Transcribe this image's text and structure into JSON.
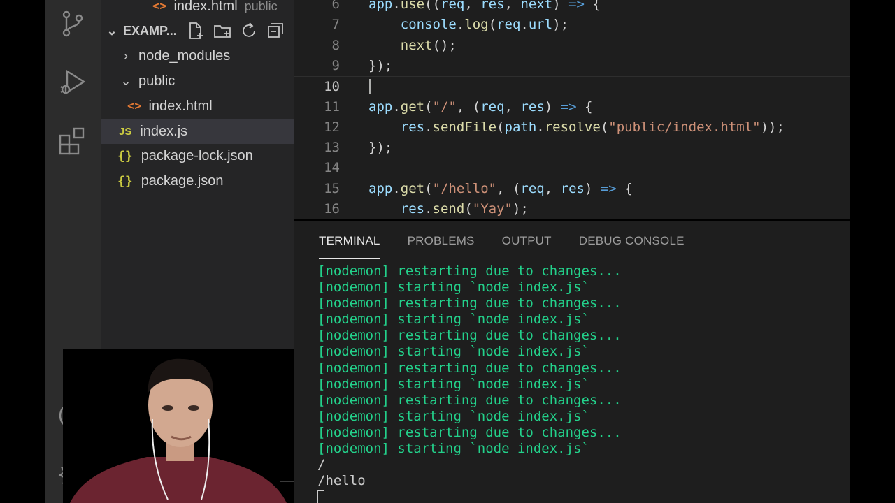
{
  "activity_bar": {
    "icons": [
      "source-control-icon",
      "run-debug-icon",
      "extensions-icon",
      "account-icon",
      "settings-gear-icon"
    ]
  },
  "sidebar": {
    "open_editor_row": {
      "name": "index.html",
      "hint": "public",
      "icon": "<>"
    },
    "explorer_title": "EXAMP...",
    "header_actions": [
      "new-file-icon",
      "new-folder-icon",
      "refresh-icon",
      "collapse-all-icon"
    ],
    "tree": [
      {
        "name": "node_modules",
        "chevron": "›",
        "icon": ""
      },
      {
        "name": "public",
        "chevron": "⌄",
        "icon": ""
      },
      {
        "name": "index.html",
        "icon": "<>"
      },
      {
        "name": "index.js",
        "icon": "JS"
      },
      {
        "name": "package-lock.json",
        "icon": "{}"
      },
      {
        "name": "package.json",
        "icon": "{}"
      }
    ]
  },
  "editor": {
    "line_numbers": [
      "6",
      "7",
      "8",
      "9",
      "10",
      "11",
      "12",
      "13",
      "14",
      "15",
      "16"
    ],
    "lines": [
      [
        [
          "app",
          "t-id"
        ],
        [
          ".",
          "t-p"
        ],
        [
          "use",
          "t-fn"
        ],
        [
          "((",
          "t-p"
        ],
        [
          "req",
          "t-id"
        ],
        [
          ", ",
          "t-p"
        ],
        [
          "res",
          "t-id"
        ],
        [
          ", ",
          "t-p"
        ],
        [
          "next",
          "t-id"
        ],
        [
          ") ",
          "t-p"
        ],
        [
          "=>",
          "t-kw"
        ],
        [
          " {",
          "t-p"
        ]
      ],
      [
        [
          "    ",
          "t-p"
        ],
        [
          "console",
          "t-id"
        ],
        [
          ".",
          "t-p"
        ],
        [
          "log",
          "t-fn"
        ],
        [
          "(",
          "t-p"
        ],
        [
          "req",
          "t-id"
        ],
        [
          ".",
          "t-p"
        ],
        [
          "url",
          "t-id"
        ],
        [
          ");",
          "t-p"
        ]
      ],
      [
        [
          "    ",
          "t-p"
        ],
        [
          "next",
          "t-fn"
        ],
        [
          "();",
          "t-p"
        ]
      ],
      [
        [
          "});",
          "t-p"
        ]
      ],
      [],
      [
        [
          "app",
          "t-id"
        ],
        [
          ".",
          "t-p"
        ],
        [
          "get",
          "t-fn"
        ],
        [
          "(",
          "t-p"
        ],
        [
          "\"/\"",
          "t-str"
        ],
        [
          ", (",
          "t-p"
        ],
        [
          "req",
          "t-id"
        ],
        [
          ", ",
          "t-p"
        ],
        [
          "res",
          "t-id"
        ],
        [
          ") ",
          "t-p"
        ],
        [
          "=>",
          "t-kw"
        ],
        [
          " {",
          "t-p"
        ]
      ],
      [
        [
          "    ",
          "t-p"
        ],
        [
          "res",
          "t-id"
        ],
        [
          ".",
          "t-p"
        ],
        [
          "sendFile",
          "t-fn"
        ],
        [
          "(",
          "t-p"
        ],
        [
          "path",
          "t-id"
        ],
        [
          ".",
          "t-p"
        ],
        [
          "resolve",
          "t-fn"
        ],
        [
          "(",
          "t-p"
        ],
        [
          "\"public/index.html\"",
          "t-str"
        ],
        [
          "));",
          "t-p"
        ]
      ],
      [
        [
          "});",
          "t-p"
        ]
      ],
      [],
      [
        [
          "app",
          "t-id"
        ],
        [
          ".",
          "t-p"
        ],
        [
          "get",
          "t-fn"
        ],
        [
          "(",
          "t-p"
        ],
        [
          "\"/hello\"",
          "t-str"
        ],
        [
          ", (",
          "t-p"
        ],
        [
          "req",
          "t-id"
        ],
        [
          ", ",
          "t-p"
        ],
        [
          "res",
          "t-id"
        ],
        [
          ") ",
          "t-p"
        ],
        [
          "=>",
          "t-kw"
        ],
        [
          " {",
          "t-p"
        ]
      ],
      [
        [
          "    ",
          "t-p"
        ],
        [
          "res",
          "t-id"
        ],
        [
          ".",
          "t-p"
        ],
        [
          "send",
          "t-fn"
        ],
        [
          "(",
          "t-p"
        ],
        [
          "\"Yay\"",
          "t-str"
        ],
        [
          ");",
          "t-p"
        ]
      ]
    ]
  },
  "panel": {
    "tabs": [
      "TERMINAL",
      "PROBLEMS",
      "OUTPUT",
      "DEBUG CONSOLE"
    ],
    "active_tab": "TERMINAL",
    "terminal_lines": [
      {
        "text": "[nodemon] restarting due to changes...",
        "style": "green"
      },
      {
        "text": "[nodemon] starting `node index.js`",
        "style": "green"
      },
      {
        "text": "[nodemon] restarting due to changes...",
        "style": "green"
      },
      {
        "text": "[nodemon] starting `node index.js`",
        "style": "green"
      },
      {
        "text": "[nodemon] restarting due to changes...",
        "style": "green"
      },
      {
        "text": "[nodemon] starting `node index.js`",
        "style": "green"
      },
      {
        "text": "[nodemon] restarting due to changes...",
        "style": "green"
      },
      {
        "text": "[nodemon] starting `node index.js`",
        "style": "green"
      },
      {
        "text": "[nodemon] restarting due to changes...",
        "style": "green"
      },
      {
        "text": "[nodemon] starting `node index.js`",
        "style": "green"
      },
      {
        "text": "[nodemon] restarting due to changes...",
        "style": "green"
      },
      {
        "text": "[nodemon] starting `node index.js`",
        "style": "green"
      },
      {
        "text": "/",
        "style": "plain"
      },
      {
        "text": "/hello",
        "style": "plain"
      }
    ]
  }
}
